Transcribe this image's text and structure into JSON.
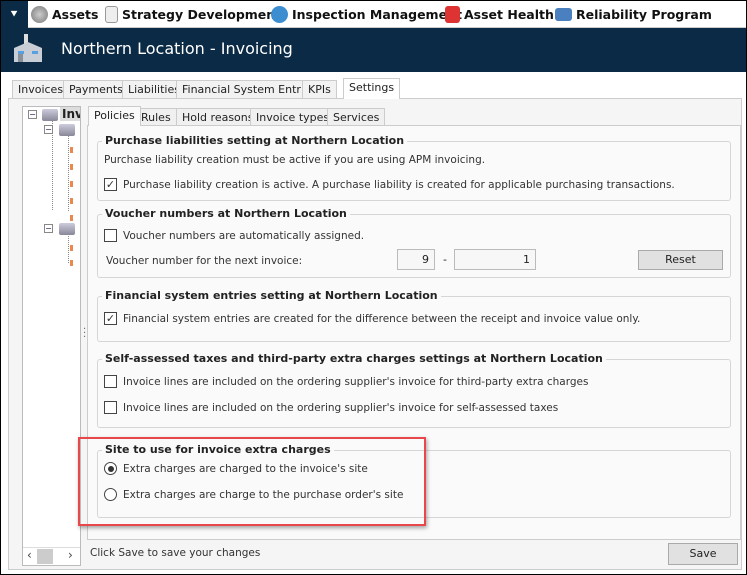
{
  "top_nav": {
    "toggle_icon": "double-chevron-down",
    "items": [
      {
        "label": "Assets",
        "icon": "gears-icon"
      },
      {
        "label": "Strategy Development",
        "icon": "document-icon"
      },
      {
        "label": "Inspection Management",
        "icon": "gauge-icon"
      },
      {
        "label": "Asset Health",
        "icon": "health-kit-icon"
      },
      {
        "label": "Reliability Program",
        "icon": "folder-icon"
      }
    ]
  },
  "header": {
    "title": "Northern Location - Invoicing",
    "icon": "factory-icon"
  },
  "tabs": [
    {
      "label": "Invoices"
    },
    {
      "label": "Payments"
    },
    {
      "label": "Liabilities"
    },
    {
      "label": "Financial System Entries"
    },
    {
      "label": "KPIs"
    },
    {
      "label": "Settings",
      "active": true
    }
  ],
  "tree": {
    "root_label": "Inv"
  },
  "inner_tabs": [
    {
      "label": "Policies",
      "active": true
    },
    {
      "label": "Rules"
    },
    {
      "label": "Hold reasons"
    },
    {
      "label": "Invoice types"
    },
    {
      "label": "Services"
    }
  ],
  "groups": {
    "purchase": {
      "title": "Purchase liabilities setting at Northern Location",
      "note": "Purchase liability creation must be active if you are using APM invoicing.",
      "checkbox_label": "Purchase liability creation is active. A purchase liability is created for applicable purchasing transactions.",
      "checked": true
    },
    "voucher": {
      "title": "Voucher numbers at Northern Location",
      "checkbox_label": "Voucher numbers are automatically assigned.",
      "checked": false,
      "next_label": "Voucher number for the next invoice:",
      "prefix_value": "9",
      "separator": "-",
      "number_value": "1",
      "reset_label": "Reset"
    },
    "financial": {
      "title": "Financial system entries setting at Northern Location",
      "checkbox_label": "Financial system entries are created for the difference between the receipt and invoice value only.",
      "checked": true
    },
    "taxes": {
      "title": "Self-assessed taxes and third-party extra charges settings at Northern Location",
      "options": [
        {
          "label": "Invoice lines are included on the ordering supplier's invoice for third-party extra charges",
          "checked": false
        },
        {
          "label": "Invoice lines are included on the ordering supplier's invoice for self-assessed taxes",
          "checked": false
        }
      ]
    },
    "site": {
      "title": "Site to use for invoice extra charges",
      "options": [
        {
          "label": "Extra charges are charged to the invoice's site",
          "selected": true
        },
        {
          "label": "Extra charges are charge to the purchase order's site",
          "selected": false
        }
      ]
    }
  },
  "footer": {
    "status": "Click Save to save your changes",
    "save_label": "Save"
  },
  "colors": {
    "header_bg": "#0b2a45",
    "highlight": "#e8474b"
  }
}
